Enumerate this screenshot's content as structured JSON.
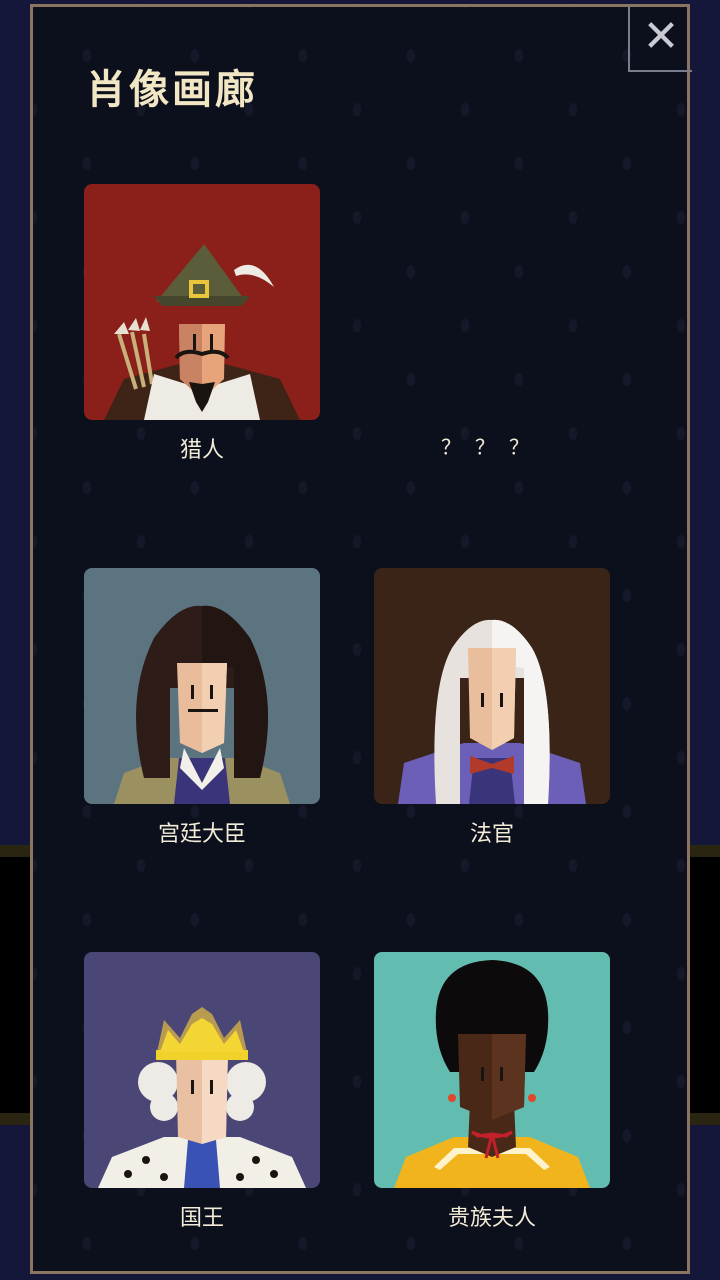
{
  "gallery": {
    "title": "肖像画廊",
    "close_icon": "close-icon",
    "portraits": [
      {
        "name": "猎人",
        "bg": "#8b1f19",
        "unlocked": true
      },
      {
        "name": "？？？",
        "unlocked": false
      },
      {
        "name": "宫廷大臣",
        "bg": "#5c7480",
        "unlocked": true
      },
      {
        "name": "法官",
        "bg": "#3a2418",
        "unlocked": true
      },
      {
        "name": "国王",
        "bg": "#4a4676",
        "unlocked": true
      },
      {
        "name": "贵族夫人",
        "bg": "#63bcb0",
        "unlocked": true
      }
    ]
  }
}
